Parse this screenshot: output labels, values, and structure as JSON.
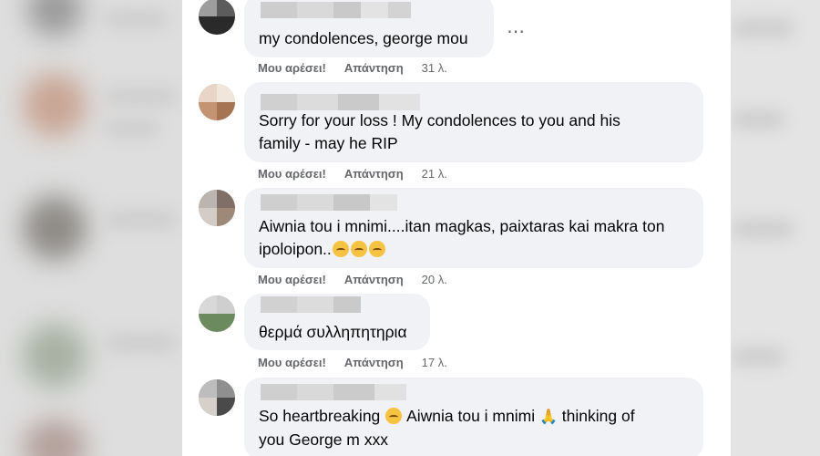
{
  "comments": [
    {
      "text_lines": [
        "my condolences, george mou"
      ],
      "like_label": "Μου αρέσει!",
      "reply_label": "Απάντηση",
      "time": "31 λ."
    },
    {
      "text_lines": [
        "Sorry for your loss ! My condolences to you and his",
        "family - may he RIP"
      ],
      "like_label": "Μου αρέσει!",
      "reply_label": "Απάντηση",
      "time": "21 λ."
    },
    {
      "text_lines": [
        "Aiwnia tou i mnimi....itan magkas, paixtaras kai makra ton",
        "ipoloipon.."
      ],
      "like_label": "Μου αρέσει!",
      "reply_label": "Απάντηση",
      "time": "20 λ."
    },
    {
      "text_lines": [
        "θερμά συλληπητηρια"
      ],
      "like_label": "Μου αρέσει!",
      "reply_label": "Απάντηση",
      "time": "17 λ."
    },
    {
      "text_line1_a": "So heartbreaking",
      "text_line1_b": "Aiwnia tou i mnimi",
      "text_line1_c": "thinking of",
      "text_line2": "you George m xxx",
      "emoji_pray": "🙏"
    }
  ],
  "more_options_icon": "⋯",
  "colors": {
    "bubble": "#f0f2f5",
    "action_text": "#65676b",
    "text": "#050505"
  },
  "icons": {
    "emoji": "pensive-face-icon",
    "more": "more-options-icon"
  }
}
